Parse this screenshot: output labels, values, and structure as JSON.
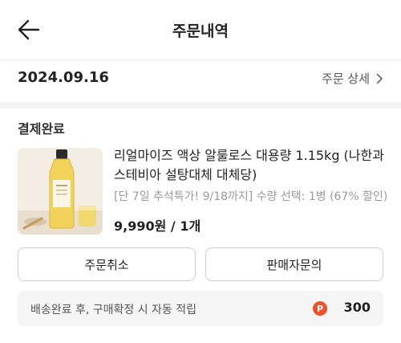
{
  "header": {
    "title": "주문내역",
    "back_icon": "arrow-left-icon"
  },
  "order": {
    "date": "2024.09.16",
    "detail_link": "주문 상세",
    "detail_icon": "chevron-right-icon",
    "status": "결제완료"
  },
  "product": {
    "name": "리얼마이즈 액상 알룰로스 대용량 1.15kg (나한과 스테비아 설탕대체 대체당)",
    "option": "[단 7일 추석특가! 9/18까지] 수량 선택: 1병 (67% 할인)",
    "price_quantity": "9,990원 / 1개",
    "thumbnail_icon": "product-bottle-image"
  },
  "actions": {
    "cancel_label": "주문취소",
    "inquiry_label": "판매자문의"
  },
  "points": {
    "text": "배송완료 후, 구매확정 시 자동 적립",
    "icon_letter": "P",
    "value": "300",
    "icon_color": "#f0502a"
  }
}
